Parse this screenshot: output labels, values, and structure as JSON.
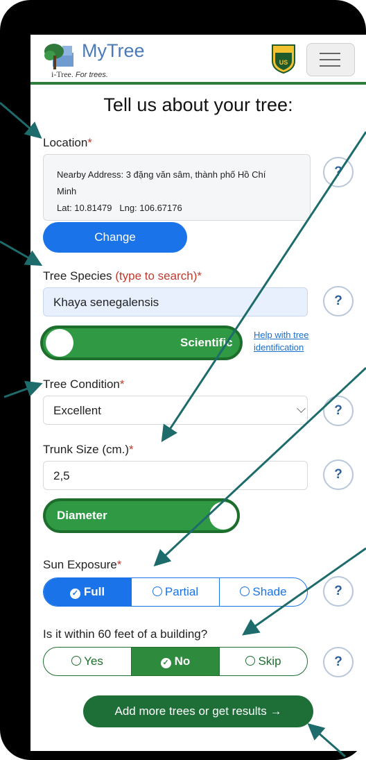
{
  "header": {
    "brand": "MyTree",
    "sub_itree": "i-Tree.",
    "sub_tagline": "For trees.",
    "usda_badge": "USDA",
    "menu_icon": "hamburger-icon"
  },
  "heading": "Tell us about your tree:",
  "location": {
    "label": "Location",
    "required": "*",
    "address_line1": "Nearby Address: 3 đặng văn sâm, thành phố Hồ Chí",
    "address_line2": "Minh",
    "coords": "Lat: 10.81479   Lng: 106.67176",
    "change_button": "Change",
    "help": "?"
  },
  "species": {
    "label": "Tree Species",
    "hint": "(type to search)",
    "required": "*",
    "value": "Khaya senegalensis",
    "toggle_label": "Scientific",
    "help_link_line1": "Help with tree",
    "help_link_line2": "identification",
    "help": "?"
  },
  "condition": {
    "label": "Tree Condition",
    "required": "*",
    "selected": "Excellent",
    "help": "?"
  },
  "trunk": {
    "label": "Trunk Size (cm.)",
    "required": "*",
    "value": "2,5",
    "toggle_label": "Diameter",
    "help": "?"
  },
  "sun": {
    "label": "Sun Exposure",
    "required": "*",
    "options": [
      "Full",
      "Partial",
      "Shade"
    ],
    "selected": "Full",
    "help": "?"
  },
  "building": {
    "label": "Is it within 60 feet of a building?",
    "options": [
      "Yes",
      "No",
      "Skip"
    ],
    "selected": "No",
    "help": "?"
  },
  "footer": {
    "add_button": "Add more trees or get results",
    "arrow": "→"
  },
  "colors": {
    "primary_blue": "#1a73e8",
    "toggle_green": "#2f9a43",
    "button_green": "#1e6e38",
    "required_red": "#c0392b",
    "annotation_teal": "#1d6b6b"
  }
}
